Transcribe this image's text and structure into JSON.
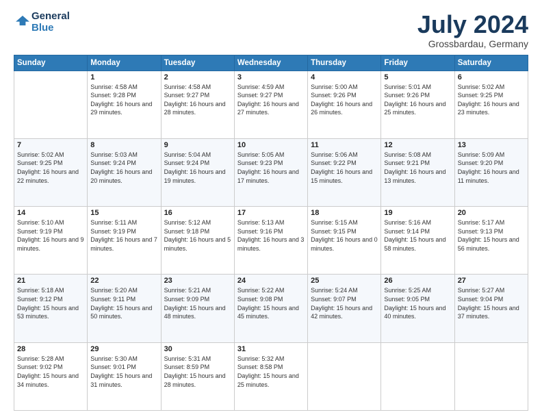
{
  "header": {
    "logo_line1": "General",
    "logo_line2": "Blue",
    "month": "July 2024",
    "location": "Grossbardau, Germany"
  },
  "weekdays": [
    "Sunday",
    "Monday",
    "Tuesday",
    "Wednesday",
    "Thursday",
    "Friday",
    "Saturday"
  ],
  "weeks": [
    [
      {
        "day": "",
        "sunrise": "",
        "sunset": "",
        "daylight": ""
      },
      {
        "day": "1",
        "sunrise": "Sunrise: 4:58 AM",
        "sunset": "Sunset: 9:28 PM",
        "daylight": "Daylight: 16 hours and 29 minutes."
      },
      {
        "day": "2",
        "sunrise": "Sunrise: 4:58 AM",
        "sunset": "Sunset: 9:27 PM",
        "daylight": "Daylight: 16 hours and 28 minutes."
      },
      {
        "day": "3",
        "sunrise": "Sunrise: 4:59 AM",
        "sunset": "Sunset: 9:27 PM",
        "daylight": "Daylight: 16 hours and 27 minutes."
      },
      {
        "day": "4",
        "sunrise": "Sunrise: 5:00 AM",
        "sunset": "Sunset: 9:26 PM",
        "daylight": "Daylight: 16 hours and 26 minutes."
      },
      {
        "day": "5",
        "sunrise": "Sunrise: 5:01 AM",
        "sunset": "Sunset: 9:26 PM",
        "daylight": "Daylight: 16 hours and 25 minutes."
      },
      {
        "day": "6",
        "sunrise": "Sunrise: 5:02 AM",
        "sunset": "Sunset: 9:25 PM",
        "daylight": "Daylight: 16 hours and 23 minutes."
      }
    ],
    [
      {
        "day": "7",
        "sunrise": "Sunrise: 5:02 AM",
        "sunset": "Sunset: 9:25 PM",
        "daylight": "Daylight: 16 hours and 22 minutes."
      },
      {
        "day": "8",
        "sunrise": "Sunrise: 5:03 AM",
        "sunset": "Sunset: 9:24 PM",
        "daylight": "Daylight: 16 hours and 20 minutes."
      },
      {
        "day": "9",
        "sunrise": "Sunrise: 5:04 AM",
        "sunset": "Sunset: 9:24 PM",
        "daylight": "Daylight: 16 hours and 19 minutes."
      },
      {
        "day": "10",
        "sunrise": "Sunrise: 5:05 AM",
        "sunset": "Sunset: 9:23 PM",
        "daylight": "Daylight: 16 hours and 17 minutes."
      },
      {
        "day": "11",
        "sunrise": "Sunrise: 5:06 AM",
        "sunset": "Sunset: 9:22 PM",
        "daylight": "Daylight: 16 hours and 15 minutes."
      },
      {
        "day": "12",
        "sunrise": "Sunrise: 5:08 AM",
        "sunset": "Sunset: 9:21 PM",
        "daylight": "Daylight: 16 hours and 13 minutes."
      },
      {
        "day": "13",
        "sunrise": "Sunrise: 5:09 AM",
        "sunset": "Sunset: 9:20 PM",
        "daylight": "Daylight: 16 hours and 11 minutes."
      }
    ],
    [
      {
        "day": "14",
        "sunrise": "Sunrise: 5:10 AM",
        "sunset": "Sunset: 9:19 PM",
        "daylight": "Daylight: 16 hours and 9 minutes."
      },
      {
        "day": "15",
        "sunrise": "Sunrise: 5:11 AM",
        "sunset": "Sunset: 9:19 PM",
        "daylight": "Daylight: 16 hours and 7 minutes."
      },
      {
        "day": "16",
        "sunrise": "Sunrise: 5:12 AM",
        "sunset": "Sunset: 9:18 PM",
        "daylight": "Daylight: 16 hours and 5 minutes."
      },
      {
        "day": "17",
        "sunrise": "Sunrise: 5:13 AM",
        "sunset": "Sunset: 9:16 PM",
        "daylight": "Daylight: 16 hours and 3 minutes."
      },
      {
        "day": "18",
        "sunrise": "Sunrise: 5:15 AM",
        "sunset": "Sunset: 9:15 PM",
        "daylight": "Daylight: 16 hours and 0 minutes."
      },
      {
        "day": "19",
        "sunrise": "Sunrise: 5:16 AM",
        "sunset": "Sunset: 9:14 PM",
        "daylight": "Daylight: 15 hours and 58 minutes."
      },
      {
        "day": "20",
        "sunrise": "Sunrise: 5:17 AM",
        "sunset": "Sunset: 9:13 PM",
        "daylight": "Daylight: 15 hours and 56 minutes."
      }
    ],
    [
      {
        "day": "21",
        "sunrise": "Sunrise: 5:18 AM",
        "sunset": "Sunset: 9:12 PM",
        "daylight": "Daylight: 15 hours and 53 minutes."
      },
      {
        "day": "22",
        "sunrise": "Sunrise: 5:20 AM",
        "sunset": "Sunset: 9:11 PM",
        "daylight": "Daylight: 15 hours and 50 minutes."
      },
      {
        "day": "23",
        "sunrise": "Sunrise: 5:21 AM",
        "sunset": "Sunset: 9:09 PM",
        "daylight": "Daylight: 15 hours and 48 minutes."
      },
      {
        "day": "24",
        "sunrise": "Sunrise: 5:22 AM",
        "sunset": "Sunset: 9:08 PM",
        "daylight": "Daylight: 15 hours and 45 minutes."
      },
      {
        "day": "25",
        "sunrise": "Sunrise: 5:24 AM",
        "sunset": "Sunset: 9:07 PM",
        "daylight": "Daylight: 15 hours and 42 minutes."
      },
      {
        "day": "26",
        "sunrise": "Sunrise: 5:25 AM",
        "sunset": "Sunset: 9:05 PM",
        "daylight": "Daylight: 15 hours and 40 minutes."
      },
      {
        "day": "27",
        "sunrise": "Sunrise: 5:27 AM",
        "sunset": "Sunset: 9:04 PM",
        "daylight": "Daylight: 15 hours and 37 minutes."
      }
    ],
    [
      {
        "day": "28",
        "sunrise": "Sunrise: 5:28 AM",
        "sunset": "Sunset: 9:02 PM",
        "daylight": "Daylight: 15 hours and 34 minutes."
      },
      {
        "day": "29",
        "sunrise": "Sunrise: 5:30 AM",
        "sunset": "Sunset: 9:01 PM",
        "daylight": "Daylight: 15 hours and 31 minutes."
      },
      {
        "day": "30",
        "sunrise": "Sunrise: 5:31 AM",
        "sunset": "Sunset: 8:59 PM",
        "daylight": "Daylight: 15 hours and 28 minutes."
      },
      {
        "day": "31",
        "sunrise": "Sunrise: 5:32 AM",
        "sunset": "Sunset: 8:58 PM",
        "daylight": "Daylight: 15 hours and 25 minutes."
      },
      {
        "day": "",
        "sunrise": "",
        "sunset": "",
        "daylight": ""
      },
      {
        "day": "",
        "sunrise": "",
        "sunset": "",
        "daylight": ""
      },
      {
        "day": "",
        "sunrise": "",
        "sunset": "",
        "daylight": ""
      }
    ]
  ]
}
